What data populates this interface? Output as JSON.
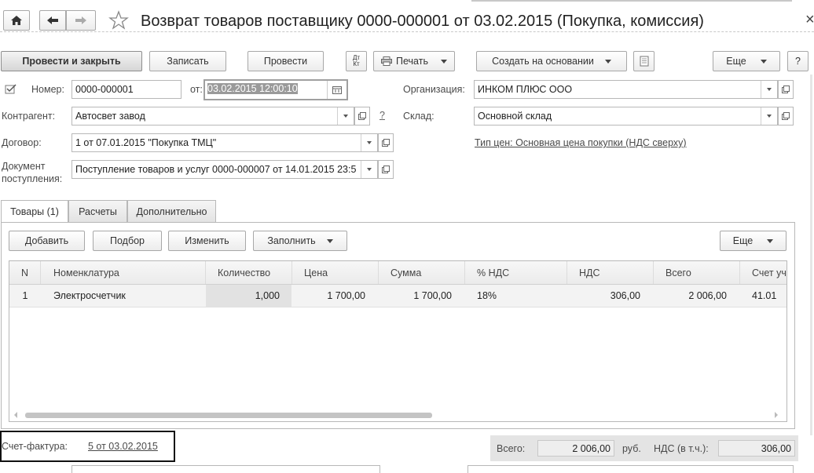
{
  "window": {
    "title": "Возврат товаров поставщику 0000-000001 от 03.02.2015 (Покупка, комиссия)",
    "close_glyph": "×"
  },
  "toolbar": {
    "post_and_close": "Провести и закрыть",
    "save": "Записать",
    "post": "Провести",
    "dt_kt": "Дт\nКт",
    "print": "Печать",
    "create_based_on": "Создать на основании",
    "more": "Еще",
    "help": "?"
  },
  "form": {
    "number_label": "Номер:",
    "number_value": "0000-000001",
    "date_label": "от:",
    "date_value": "03.02.2015 12:00:10",
    "organization_label": "Организация:",
    "organization_value": "ИНКОМ ПЛЮС ООО",
    "counterparty_label": "Контрагент:",
    "counterparty_value": "Автосвет завод",
    "counterparty_help": "?",
    "warehouse_label": "Склад:",
    "warehouse_value": "Основной склад",
    "contract_label": "Договор:",
    "contract_value": "1 от 07.01.2015 \"Покупка ТМЦ\"",
    "price_type_link": "Тип цен: Основная цена покупки (НДС сверху)",
    "receipt_doc_label_1": "Документ",
    "receipt_doc_label_2": "поступления:",
    "receipt_doc_value": "Поступление товаров и услуг 0000-000007 от 14.01.2015 23:5"
  },
  "tabs": [
    {
      "label": "Товары (1)"
    },
    {
      "label": "Расчеты"
    },
    {
      "label": "Дополнительно"
    }
  ],
  "table_toolbar": {
    "add": "Добавить",
    "pick": "Подбор",
    "edit": "Изменить",
    "fill": "Заполнить",
    "more": "Еще"
  },
  "table": {
    "columns": [
      "N",
      "Номенклатура",
      "Количество",
      "Цена",
      "Сумма",
      "% НДС",
      "НДС",
      "Всего",
      "Счет уч"
    ],
    "rows": [
      {
        "n": "1",
        "item": "Электросчетчик",
        "qty": "1,000",
        "price": "1 700,00",
        "sum": "1 700,00",
        "vat_rate": "18%",
        "vat": "306,00",
        "total": "2 006,00",
        "account": "41.01"
      }
    ]
  },
  "footer": {
    "invoice_label": "Счет-фактура:",
    "invoice_link": "5 от 03.02.2015",
    "total_label": "Всего:",
    "total_value": "2 006,00",
    "currency": "руб.",
    "vat_label": "НДС (в т.ч.):",
    "vat_value": "306,00"
  }
}
